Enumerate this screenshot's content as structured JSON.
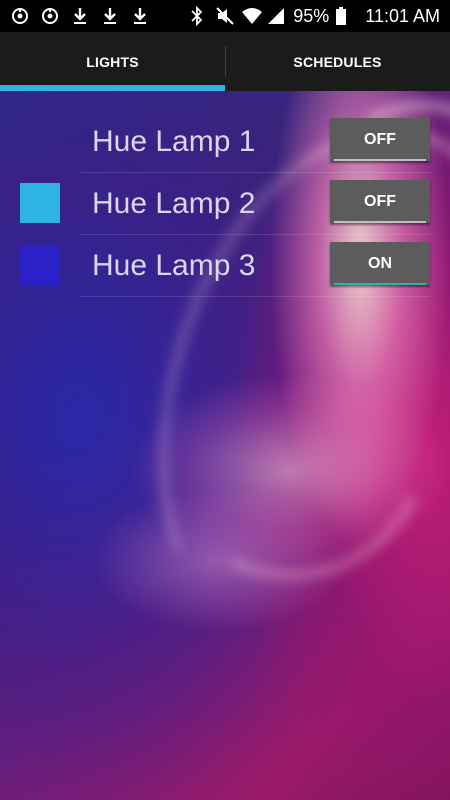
{
  "status_bar": {
    "left_icons": [
      "sync-icon",
      "sync-icon",
      "download-icon",
      "download-icon",
      "download-icon"
    ],
    "right_icons": [
      "bluetooth-icon",
      "mute-icon",
      "wifi-icon",
      "signal-icon",
      "battery-icon"
    ],
    "battery": "95%",
    "time": "11:01 AM"
  },
  "tabs": [
    {
      "label": "LIGHTS",
      "selected": true
    },
    {
      "label": "SCHEDULES",
      "selected": false
    }
  ],
  "colors": {
    "tab_indicator": "#2fb2e6",
    "button_bg": "#5c5c5c"
  },
  "lights": [
    {
      "name": "Hue Lamp 1",
      "swatch_color": null,
      "toggle_label": "OFF",
      "toggle_underline": "#c0c0c0"
    },
    {
      "name": "Hue Lamp 2",
      "swatch_color": "#2fb2e6",
      "toggle_label": "OFF",
      "toggle_underline": "#c0c0c0"
    },
    {
      "name": "Hue Lamp 3",
      "swatch_color": "#2a22c8",
      "toggle_label": "ON",
      "toggle_underline": "#2fb2a8"
    }
  ]
}
